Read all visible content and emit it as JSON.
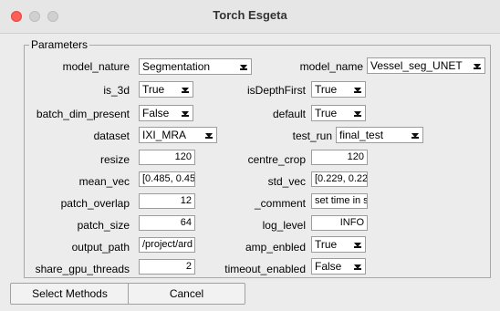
{
  "window": {
    "title": "Torch Esgeta"
  },
  "panel": {
    "legend": "Parameters"
  },
  "left": {
    "model_nature": {
      "label": "model_nature",
      "value": "Segmentation"
    },
    "is_3d": {
      "label": "is_3d",
      "value": "True"
    },
    "batch_dim_present": {
      "label": "batch_dim_present",
      "value": "False"
    },
    "dataset": {
      "label": "dataset",
      "value": "IXI_MRA"
    },
    "resize": {
      "label": "resize",
      "value": "120"
    },
    "mean_vec": {
      "label": "mean_vec",
      "value": "[0.485, 0.45"
    },
    "patch_overlap": {
      "label": "patch_overlap",
      "value": "12"
    },
    "patch_size": {
      "label": "patch_size",
      "value": "64"
    },
    "output_path": {
      "label": "output_path",
      "value": "/project/ard"
    },
    "share_gpu_threads": {
      "label": "share_gpu_threads",
      "value": "2"
    }
  },
  "right": {
    "model_name": {
      "label": "model_name",
      "value": "Vessel_seg_UNET"
    },
    "isDepthFirst": {
      "label": "isDepthFirst",
      "value": "True"
    },
    "default": {
      "label": "default",
      "value": "True"
    },
    "test_run": {
      "label": "test_run",
      "value": "final_test"
    },
    "centre_crop": {
      "label": "centre_crop",
      "value": "120"
    },
    "std_vec": {
      "label": "std_vec",
      "value": "[0.229, 0.22"
    },
    "comment": {
      "label": "_comment",
      "value": "set time in s"
    },
    "log_level": {
      "label": "log_level",
      "value": "INFO"
    },
    "amp_enbled": {
      "label": "amp_enbled",
      "value": "True"
    },
    "timeout_enabled": {
      "label": "timeout_enabled",
      "value": "False"
    }
  },
  "buttons": {
    "select_methods": "Select Methods",
    "cancel": "Cancel"
  }
}
